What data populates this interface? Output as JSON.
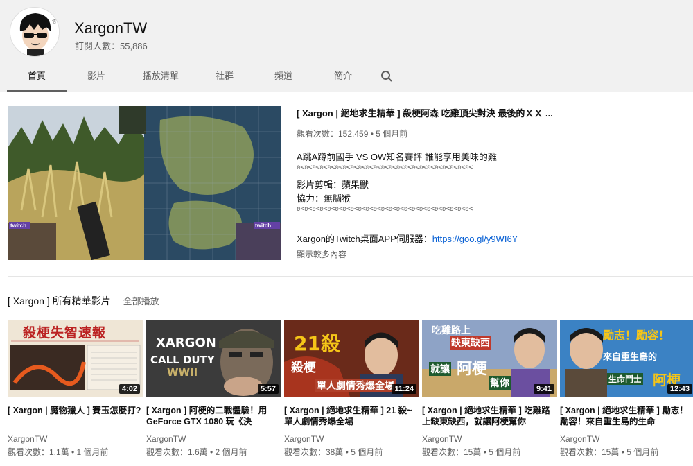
{
  "channel": {
    "name": "XargonTW",
    "subscribers": "訂閱人數：55,886"
  },
  "tabs": [
    {
      "label": "首頁"
    },
    {
      "label": "影片"
    },
    {
      "label": "播放清單"
    },
    {
      "label": "社群"
    },
    {
      "label": "頻道"
    },
    {
      "label": "簡介"
    }
  ],
  "featured": {
    "title": "[ Xargon | 絕地求生精華 ] 殺梗阿森 吃雞頂尖對決 最後的ＸＸ ...",
    "meta": "觀看次數：152,459 • 5 個月前",
    "desc": [
      "A跳A蹲前國手 VS OW知名賽評  誰能享用美味的雞",
      "ʚ<ʚ<ʚ<ʚ<ʚ<ʚ<ʚ<ʚ<ʚ<ʚ<ʚ<ʚ<ʚ<ʚ<ʚ<ʚ<ʚ<ʚ<ʚ<ʚ<ʚ<ʚ<ʚ<",
      "影片剪輯：蘋果獸",
      "協力：無腦猴",
      "ʚ<ʚ<ʚ<ʚ<ʚ<ʚ<ʚ<ʚ<ʚ<ʚ<ʚ<ʚ<ʚ<ʚ<ʚ<ʚ<ʚ<ʚ<ʚ<ʚ<ʚ<ʚ<ʚ<"
    ],
    "twitch_prefix": "Xargon的Twitch桌面APP伺服器：",
    "twitch_link": "https://goo.gl/y9WI6Y",
    "show_more": "顯示較多內容",
    "thumb_label_left": "twitch",
    "thumb_label_right": "twitch"
  },
  "shelf": {
    "title": "[ Xargon ] 所有精華影片",
    "play_all": "全部播放",
    "videos": [
      {
        "title": "[ Xargon | 魔物獵人 ] 賽玉怎麼打?",
        "channel": "XargonTW",
        "meta": "觀看次數：1.1萬 • 1 個月前",
        "duration": "4:02",
        "thumb_text": "殺梗失智速報"
      },
      {
        "title": "[ Xargon ] 阿梗的二戰體驗！用 GeForce GTX 1080 玩《決",
        "channel": "XargonTW",
        "meta": "觀看次數：1.6萬 • 2 個月前",
        "duration": "5:57",
        "thumb_text_1": "XARGON",
        "thumb_text_2": "CALL DUTY",
        "thumb_text_3": "WWII"
      },
      {
        "title": "[ Xargon | 絕地求生精華 ] 21 殺~單人劇情秀爆全場",
        "channel": "XargonTW",
        "meta": "觀看次數：38萬 • 5 個月前",
        "duration": "11:24",
        "thumb_text_1": "21殺",
        "thumb_text_2": "殺梗",
        "thumb_text_3": "單人劇情秀爆全場"
      },
      {
        "title": "[ Xargon | 絕地求生精華 ] 吃雞路上缺東缺西，就讓阿梗幫你",
        "channel": "XargonTW",
        "meta": "觀看次數：15萬 • 5 個月前",
        "duration": "9:41",
        "thumb_text_1": "吃雞路上",
        "thumb_text_2": "缺東缺西",
        "thumb_text_3": "就讓",
        "thumb_text_4": "阿梗",
        "thumb_text_5": "幫你"
      },
      {
        "title": "[ Xargon | 絕地求生精華 ] 勵志！勵容！來自重生島的生命",
        "channel": "XargonTW",
        "meta": "觀看次數：15萬 • 5 個月前",
        "duration": "12:43",
        "thumb_text_1": "勵志！勵容！",
        "thumb_text_2": "來自重生島的",
        "thumb_text_3": "生命鬥士",
        "thumb_text_4": "阿梗"
      }
    ]
  },
  "colors": {
    "header_bg": "#f1f1f1",
    "link": "#065fd4",
    "secondary_text": "#606060"
  }
}
